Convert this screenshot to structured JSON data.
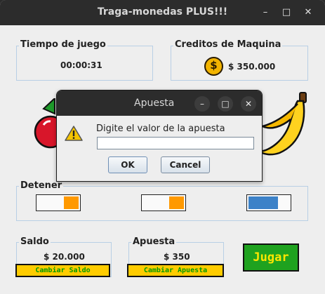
{
  "window": {
    "title": "Traga-monedas PLUS!!!",
    "controls": [
      "–",
      "□",
      "✕"
    ]
  },
  "game_time": {
    "label": "Tiempo de juego",
    "value": "00:00:31"
  },
  "machine_credits": {
    "label": "Creditos de Maquina",
    "value": "$ 350.000",
    "icon": "coin-dollar-icon"
  },
  "reels": {
    "images": [
      "cherry-icon",
      "banana-icon"
    ]
  },
  "stop": {
    "label": "Detener",
    "toggles": [
      {
        "fill_color": "#ff9900",
        "level": 0.35
      },
      {
        "fill_color": "#ff9900",
        "level": 0.35
      },
      {
        "fill_color": "#3d82c8",
        "level": 0.7
      }
    ]
  },
  "balance": {
    "label": "Saldo",
    "value": "$ 20.000",
    "button": "Cambiar Saldo"
  },
  "bet": {
    "label": "Apuesta",
    "value": "$ 350",
    "button": "Cambiar Apuesta"
  },
  "play_button": "Jugar",
  "dialog": {
    "title": "Apuesta",
    "message": "Digite el valor de la apuesta",
    "input_value": "",
    "ok": "OK",
    "cancel": "Cancel",
    "controls": [
      "–",
      "□",
      "✕"
    ]
  },
  "colors": {
    "title_bar": "#2c2c2c",
    "button_yellow": "#ffcc00",
    "button_text_green": "#009900",
    "play_green": "#1fa21f",
    "play_text": "#ffe600",
    "group_border": "#b8cfe5"
  }
}
